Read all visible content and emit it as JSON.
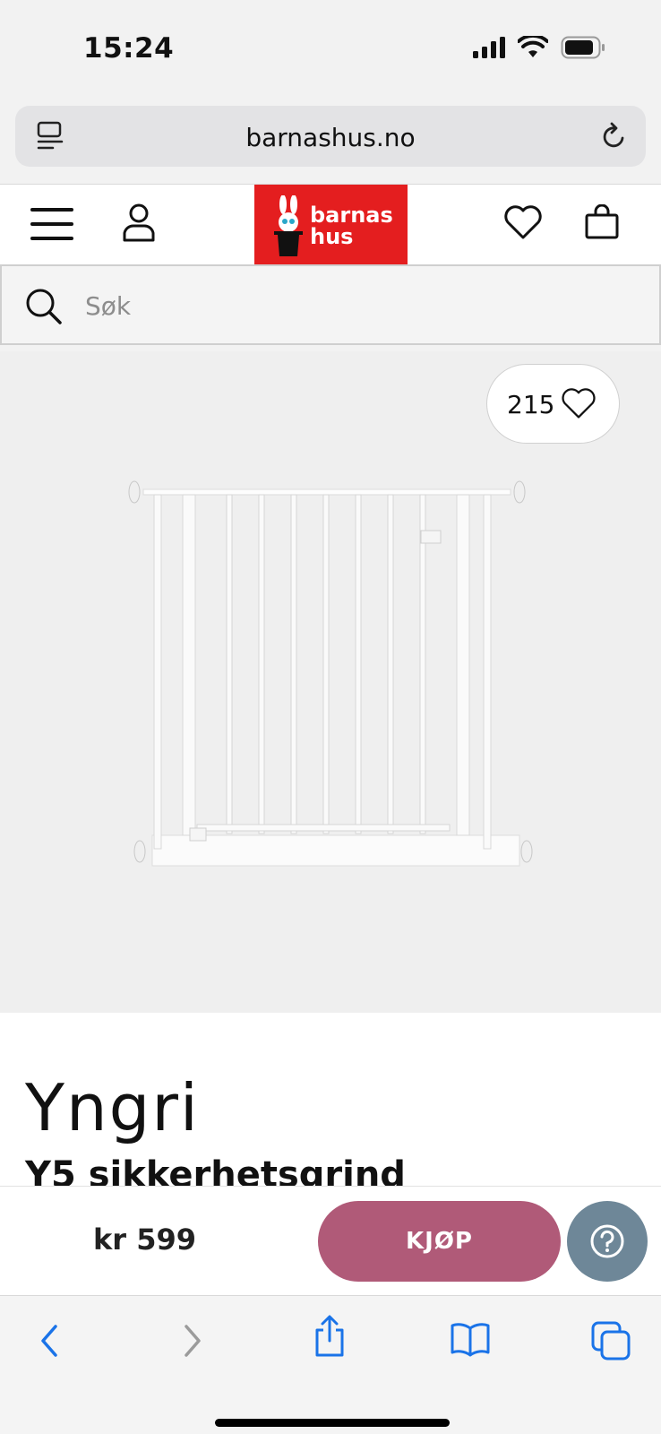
{
  "status_bar": {
    "time": "15:24"
  },
  "browser": {
    "url": "barnashus.no"
  },
  "header": {
    "logo_line1": "barnas",
    "logo_line2": "hus"
  },
  "search": {
    "placeholder": "Søk"
  },
  "product": {
    "wishlist_count": "215",
    "brand": "Yngri",
    "title": "Y5 sikkerhetsgrind",
    "price": "kr 599",
    "buy_label": "KJØP"
  },
  "colors": {
    "brand_red": "#e41e1f",
    "buy_button": "#b05a78",
    "help_button": "#6e8798",
    "ios_blue": "#1a73e8"
  },
  "icons": {
    "menu": "hamburger-icon",
    "account": "user-icon",
    "wishlist": "heart-icon",
    "cart": "shopping-bag-icon",
    "search": "search-icon",
    "help": "question-mark-icon",
    "back": "chevron-left-icon",
    "forward": "chevron-right-icon",
    "share": "share-icon",
    "bookmarks": "book-icon",
    "tabs": "tabs-icon"
  }
}
